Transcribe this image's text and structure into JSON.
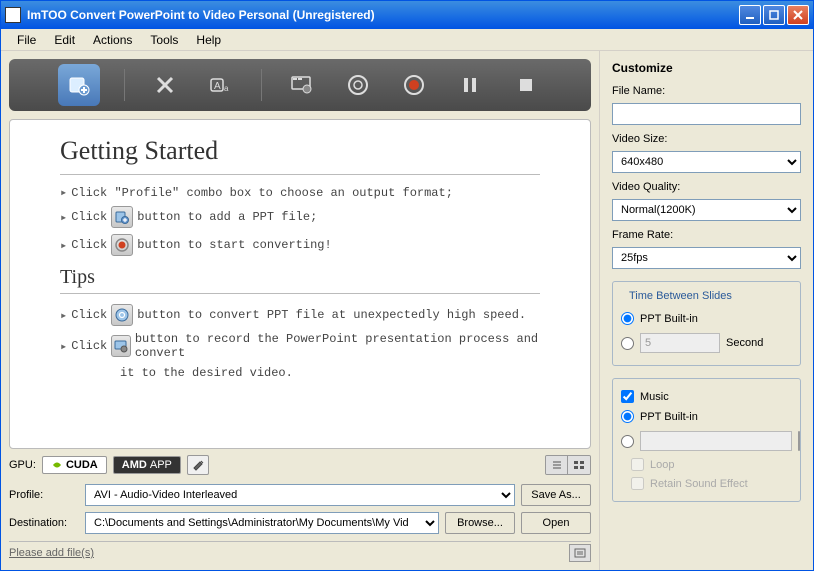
{
  "titlebar": {
    "title": "ImTOO Convert PowerPoint to Video Personal (Unregistered)"
  },
  "menu": {
    "file": "File",
    "edit": "Edit",
    "actions": "Actions",
    "tools": "Tools",
    "help": "Help"
  },
  "content": {
    "h1": "Getting Started",
    "step1a": "Click \"Profile\" combo box to choose an output format;",
    "step2a": "Click",
    "step2b": "button to add a PPT file;",
    "step3a": "Click",
    "step3b": "button to start converting!",
    "h2": "Tips",
    "tip1a": "Click",
    "tip1b": "button to convert PPT file at unexpectedly high speed.",
    "tip2a": "Click",
    "tip2b": "button to record the PowerPoint presentation process and convert",
    "tip2c": "it to the desired video."
  },
  "gpu": {
    "label": "GPU:",
    "cuda": "CUDA",
    "amd": "AMD",
    "app": "APP"
  },
  "profile": {
    "label": "Profile:",
    "value": "AVI - Audio-Video Interleaved",
    "saveas": "Save As..."
  },
  "destination": {
    "label": "Destination:",
    "value": "C:\\Documents and Settings\\Administrator\\My Documents\\My Vid",
    "browse": "Browse...",
    "open": "Open"
  },
  "status": "Please add file(s)",
  "customize": {
    "title": "Customize",
    "filename_label": "File Name:",
    "filename": "",
    "videosize_label": "Video Size:",
    "videosize": "640x480",
    "quality_label": "Video Quality:",
    "quality": "Normal(1200K)",
    "framerate_label": "Frame Rate:",
    "framerate": "25fps",
    "tbs_legend": "Time Between Slides",
    "tbs_builtin": "PPT Built-in",
    "tbs_custom_val": "5",
    "tbs_unit": "Second",
    "music": "Music",
    "music_builtin": "PPT Built-in",
    "loop": "Loop",
    "retain": "Retain Sound Effect"
  }
}
